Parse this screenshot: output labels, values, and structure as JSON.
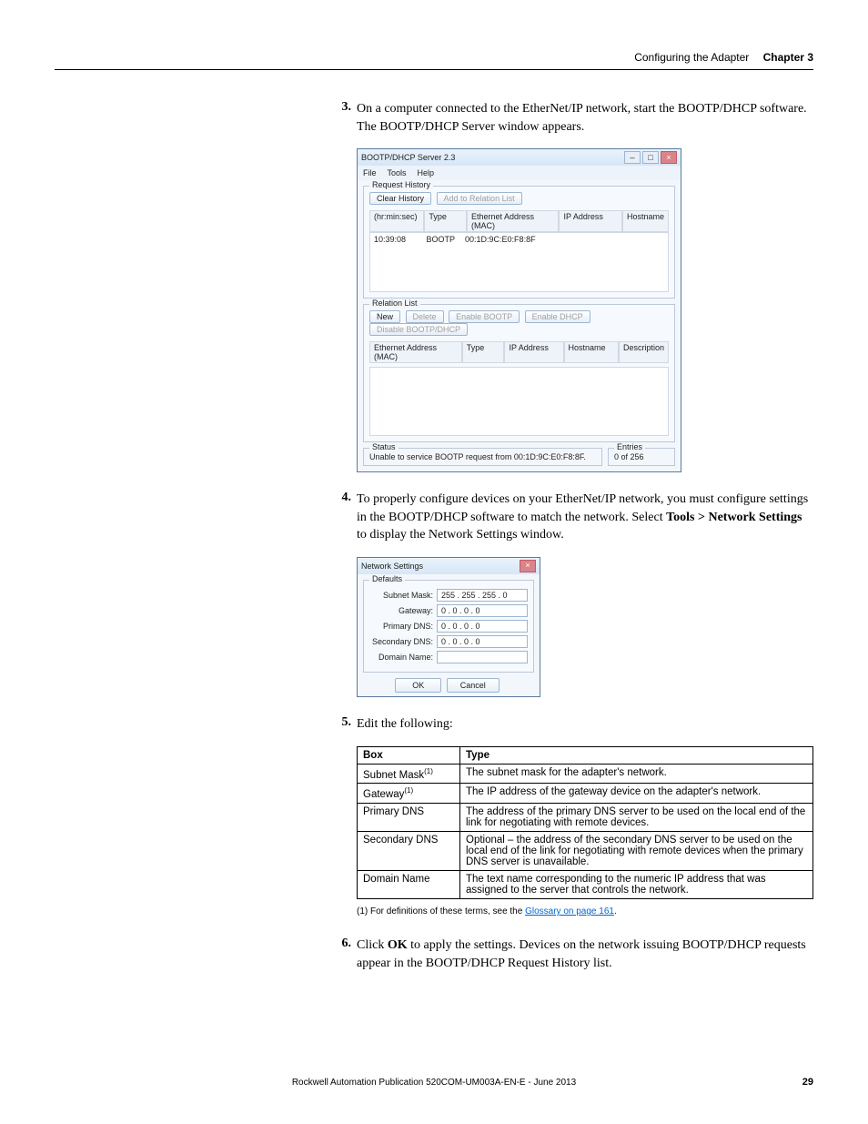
{
  "header": {
    "title": "Configuring the Adapter",
    "chapter": "Chapter 3"
  },
  "steps": {
    "s3": {
      "num": "3.",
      "text_a": "On a computer connected to the EtherNet/IP network, start the BOOTP/DHCP software. The BOOTP/DHCP Server window appears."
    },
    "s4": {
      "num": "4.",
      "text_a": "To properly configure devices on your EtherNet/IP network, you must configure settings in the BOOTP/DHCP software to match the network. Select ",
      "bold": "Tools > Network Settings",
      "text_b": " to display the Network Settings window."
    },
    "s5": {
      "num": "5.",
      "text_a": "Edit the following:"
    },
    "s6": {
      "num": "6.",
      "text_a": "Click ",
      "bold": "OK",
      "text_b": " to apply the settings. Devices on the network issuing BOOTP/DHCP requests appear in the BOOTP/DHCP Request History list."
    }
  },
  "bootp_window": {
    "title": "BOOTP/DHCP Server 2.3",
    "menu": {
      "file": "File",
      "tools": "Tools",
      "help": "Help"
    },
    "request_history": {
      "title": "Request History",
      "clear_btn": "Clear History",
      "add_btn": "Add to Relation List",
      "cols": {
        "time": "(hr:min:sec)",
        "type": "Type",
        "mac": "Ethernet Address (MAC)",
        "ip": "IP Address",
        "host": "Hostname"
      },
      "row": {
        "time": "10:39:08",
        "type": "BOOTP",
        "mac": "00:1D:9C:E0:F8:8F"
      }
    },
    "relation_list": {
      "title": "Relation List",
      "new_btn": "New",
      "delete_btn": "Delete",
      "enable_bootp": "Enable BOOTP",
      "enable_dhcp": "Enable DHCP",
      "disable": "Disable BOOTP/DHCP",
      "cols": {
        "mac": "Ethernet Address (MAC)",
        "type": "Type",
        "ip": "IP Address",
        "host": "Hostname",
        "desc": "Description"
      }
    },
    "status": {
      "label": "Status",
      "text": "Unable to service BOOTP request from 00:1D:9C:E0:F8:8F."
    },
    "entries": {
      "label": "Entries",
      "text": "0 of 256"
    }
  },
  "ns_window": {
    "title": "Network Settings",
    "defaults": "Defaults",
    "rows": {
      "subnet": {
        "label": "Subnet Mask:",
        "val": "255 . 255 . 255 .   0"
      },
      "gateway": {
        "label": "Gateway:",
        "val": "0 .   0 .   0 .   0"
      },
      "pdns": {
        "label": "Primary DNS:",
        "val": "0 .   0 .   0 .   0"
      },
      "sdns": {
        "label": "Secondary DNS:",
        "val": "0 .   0 .   0 .   0"
      },
      "domain": {
        "label": "Domain Name:"
      }
    },
    "ok": "OK",
    "cancel": "Cancel"
  },
  "table": {
    "head": {
      "box": "Box",
      "type": "Type"
    },
    "rows": [
      {
        "box_html": "Subnet Mask",
        "sup": "(1)",
        "type": "The subnet mask for the adapter's network."
      },
      {
        "box_html": "Gateway",
        "sup": "(1)",
        "type": "The IP address of the gateway device on the adapter's network."
      },
      {
        "box_html": "Primary DNS",
        "sup": "",
        "type": "The address of the primary DNS server to be used on the local end of the link for negotiating with remote devices."
      },
      {
        "box_html": "Secondary DNS",
        "sup": "",
        "type": "Optional – the address of the secondary DNS server to be used on the local end of the link for negotiating with remote devices when the primary DNS server is unavailable."
      },
      {
        "box_html": "Domain Name",
        "sup": "",
        "type": "The text name corresponding to the numeric IP address that was assigned to the server that controls the network."
      }
    ],
    "footnote_prefix": "(1)   For definitions of these terms, see the ",
    "footnote_link": "Glossary on page 161",
    "footnote_suffix": "."
  },
  "footer": {
    "pub": "Rockwell Automation Publication 520COM-UM003A-EN-E - June 2013",
    "page": "29"
  }
}
